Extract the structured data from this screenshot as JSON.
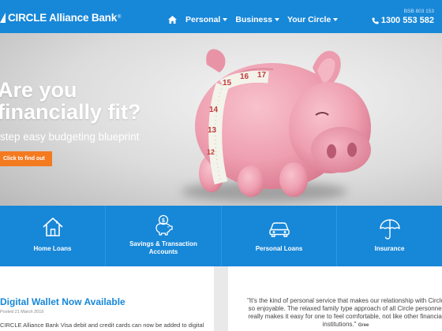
{
  "header": {
    "logo_text": "CIRCLE Alliance Bank",
    "logo_tm": "®",
    "nav": [
      {
        "label": "Personal"
      },
      {
        "label": "Business"
      },
      {
        "label": "Your Circle"
      }
    ],
    "bsb": "BSB 803 153",
    "phone": "1300 553 582"
  },
  "hero": {
    "title_line1": "Are you",
    "title_line2": "financially fit?",
    "subtitle": "step easy budgeting blueprint",
    "cta": "Click to find out",
    "tape_numbers": [
      "12",
      "13",
      "14",
      "15",
      "16",
      "17"
    ]
  },
  "tiles": [
    {
      "label": "Home Loans",
      "icon": "house-icon"
    },
    {
      "label": "Savings & Transaction Accounts",
      "icon": "piggy-bank-icon"
    },
    {
      "label": "Personal Loans",
      "icon": "car-icon"
    },
    {
      "label": "Insurance",
      "icon": "umbrella-icon"
    }
  ],
  "news": {
    "title": "Digital Wallet Now Available",
    "date": "Posted 21 March 2019",
    "text": "CIRCLE Alliance Bank Visa debit and credit cards can now be added to digital"
  },
  "testimonial": {
    "quote": "\"It's the kind of personal service that makes our relationship with Circle so enjoyable. The relaxed family type approach of all Circle personnel really makes it easy for one to feel comfortable, not like other financial institutions.\"",
    "author": "Gree"
  },
  "colors": {
    "brand_blue": "#1787d8",
    "cta_orange": "#f47a20",
    "pig_pink": "#f2a6b5"
  }
}
